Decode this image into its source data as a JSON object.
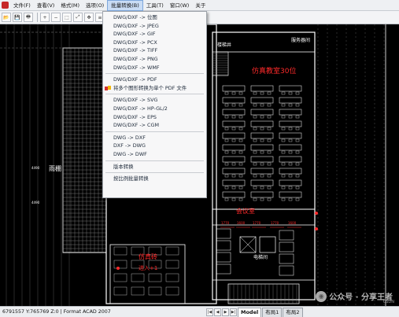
{
  "menubar": {
    "items": [
      {
        "label": "文件(F)"
      },
      {
        "label": "查看(V)"
      },
      {
        "label": "格式(M)"
      },
      {
        "label": "选项(O)"
      },
      {
        "label": "批量转换(B)"
      },
      {
        "label": "工具(T)"
      },
      {
        "label": "窗口(W)"
      },
      {
        "label": "关于"
      }
    ],
    "active_index": 4
  },
  "toolbar": {
    "buttons": [
      {
        "icon": "open-folder-icon"
      },
      {
        "icon": "save-icon"
      },
      {
        "icon": "print-icon"
      },
      {
        "icon": "zoom-in-icon"
      },
      {
        "icon": "zoom-out-icon"
      },
      {
        "icon": "zoom-window-icon"
      },
      {
        "icon": "zoom-extents-icon"
      },
      {
        "icon": "pan-icon"
      },
      {
        "icon": "layers-icon"
      },
      {
        "icon": "black-background-icon"
      },
      {
        "icon": "white-background-icon"
      },
      {
        "icon": "info-icon",
        "glyph": "i"
      }
    ]
  },
  "dropdown": {
    "items": [
      {
        "label": "DWG/DXF -> 位图"
      },
      {
        "label": "DWG/DXF -> JPEG"
      },
      {
        "label": "DWG/DXF -> GIF"
      },
      {
        "label": "DWG/DXF -> PCX"
      },
      {
        "label": "DWG/DXF -> TIFF"
      },
      {
        "label": "DWG/DXF -> PNG"
      },
      {
        "label": "DWG/DXF -> WMF"
      },
      {
        "separator": true
      },
      {
        "label": "DWG/DXF -> PDF"
      },
      {
        "label": "将多个图形转换为单个 PDF 文件",
        "icon": "pdf-merge-icon"
      },
      {
        "separator": true
      },
      {
        "label": "DWG/DXF -> SVG"
      },
      {
        "label": "DWG/DXF -> HP-GL/2"
      },
      {
        "label": "DWG/DXF -> EPS"
      },
      {
        "label": "DWG/DXF -> CGM"
      },
      {
        "separator": true
      },
      {
        "label": "DWG -> DXF"
      },
      {
        "label": "DXF -> DWG"
      },
      {
        "label": "DWG -> DWF"
      },
      {
        "separator": true
      },
      {
        "label": "版本转换"
      },
      {
        "separator": true
      },
      {
        "label": "按比例批量转换"
      }
    ]
  },
  "drawing": {
    "room_labels": {
      "stair_well": "楼梯井",
      "service_room": "服务器间",
      "classroom": "仿真教室30位",
      "meeting_room": "会议室",
      "elevator_room": "电梯间",
      "canopy": "雨棚",
      "simulated_room": "仿真砖",
      "entrance": "进入+1"
    },
    "dimensions": [
      "4490",
      "4490",
      "1770",
      "1600",
      "1770",
      "1770",
      "1600"
    ],
    "colors": {
      "background": "#000000",
      "wall": "#ffffff",
      "grid": "#8a8a8a",
      "text_red": "#ff2a2a",
      "desk": "#dcdcdc",
      "hatch": "#8c8c8c"
    }
  },
  "statusbar": {
    "coords": "6791557 Y:765769 Z:0 | Format ACAD 2007",
    "tabs": [
      {
        "label": "Model"
      },
      {
        "label": "布局1"
      },
      {
        "label": "布局2"
      }
    ]
  },
  "watermark": {
    "text": "公众号 · 分享王者",
    "sub": "CSDN"
  }
}
